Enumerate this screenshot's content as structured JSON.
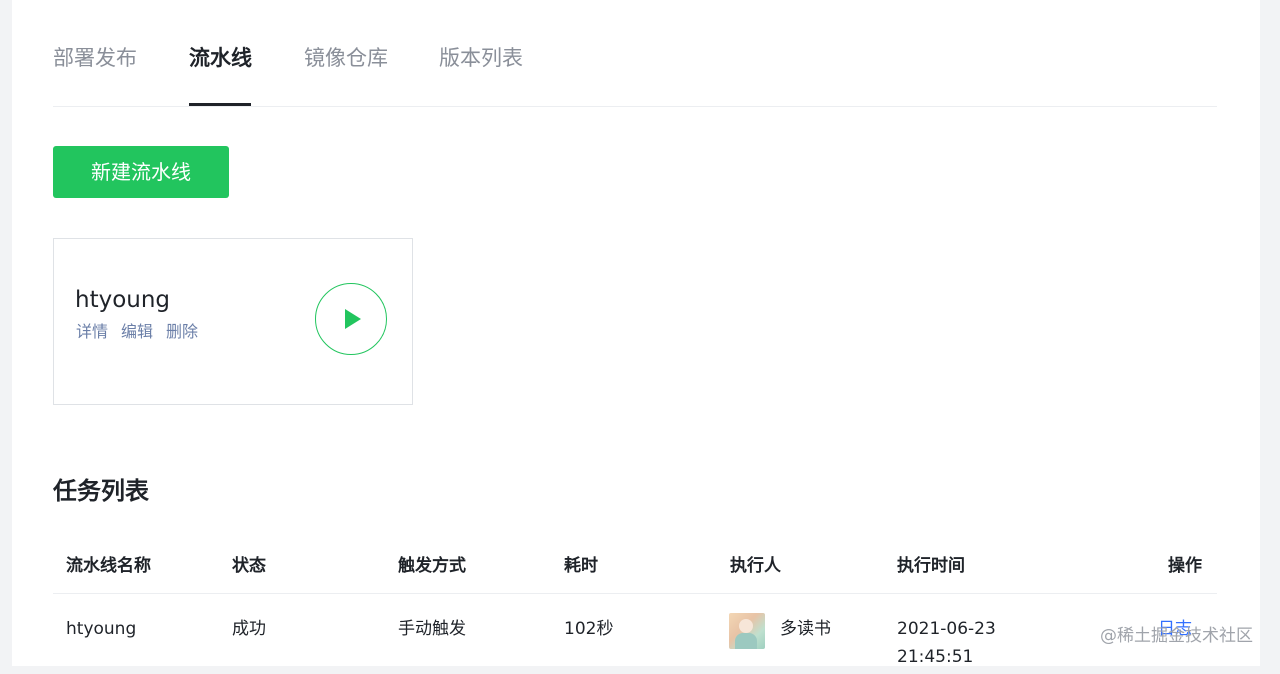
{
  "tabs": [
    {
      "label": "部署发布",
      "active": false
    },
    {
      "label": "流水线",
      "active": true
    },
    {
      "label": "镜像仓库",
      "active": false
    },
    {
      "label": "版本列表",
      "active": false
    }
  ],
  "new_pipeline_button": "新建流水线",
  "pipeline_card": {
    "name": "htyoung",
    "actions": [
      "详情",
      "编辑",
      "删除"
    ],
    "run_icon": "play-icon"
  },
  "task_section": {
    "title": "任务列表",
    "columns": [
      "流水线名称",
      "状态",
      "触发方式",
      "耗时",
      "执行人",
      "执行时间",
      "操作"
    ],
    "rows": [
      {
        "pipeline_name": "htyoung",
        "status": "成功",
        "trigger": "手动触发",
        "duration": "102秒",
        "executor": "多读书",
        "time_date": "2021-06-23",
        "time_clock": "21:45:51",
        "action": "日志"
      }
    ]
  },
  "watermark": "@稀土掘金技术社区",
  "colors": {
    "accent": "#22c55e",
    "link": "#6b7fa8"
  }
}
